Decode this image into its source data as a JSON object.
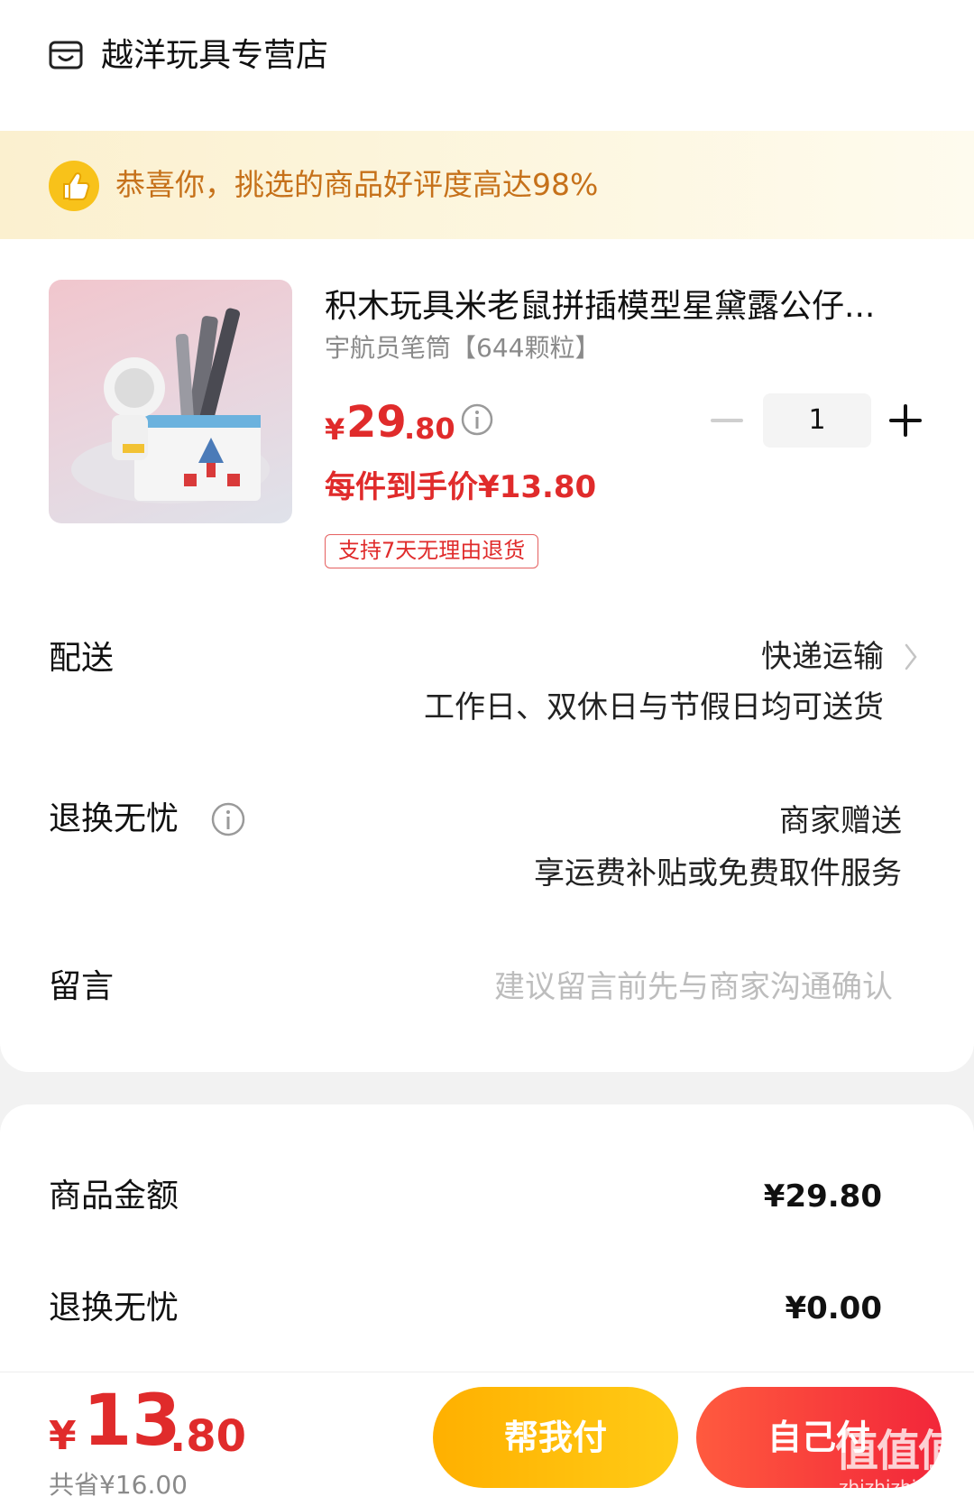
{
  "store": {
    "name": "越洋玩具专营店",
    "icon": "store-icon"
  },
  "banner": {
    "text": "恭喜你，挑选的商品好评度高达98%",
    "icon": "thumbs-up-icon"
  },
  "product": {
    "title": "积木玩具米老鼠拼插模型星黛露公仔...",
    "spec": "宇航员笔筒【644颗粒】",
    "price_currency": "¥",
    "price_int": "29",
    "price_dec": ".80",
    "unit_price": "每件到手价¥13.80",
    "return_badge": "支持7天无理由退货",
    "quantity": "1"
  },
  "delivery": {
    "label": "配送",
    "method": "快递运输",
    "detail": "工作日、双休日与节假日均可送货"
  },
  "returns": {
    "label": "退换无忧",
    "value": "商家赠送",
    "detail": "享运费补贴或免费取件服务"
  },
  "message": {
    "label": "留言",
    "placeholder": "建议留言前先与商家沟通确认"
  },
  "summary": {
    "goods_label": "商品金额",
    "goods_value": "¥29.80",
    "returns_label": "退换无忧",
    "returns_value": "¥0.00"
  },
  "footer": {
    "total_currency": "¥",
    "total_int": "13",
    "total_dec": ".80",
    "saved": "共省¥16.00",
    "help_pay": "帮我付",
    "self_pay": "自己付"
  },
  "watermark": {
    "mark": "值值值",
    "sub": "zhizhizhi.com"
  },
  "colors": {
    "accent_red": "#e02b2b",
    "banner_text": "#c6711a",
    "help_button": "#ffbb0c",
    "self_button": "#f43a3b"
  }
}
